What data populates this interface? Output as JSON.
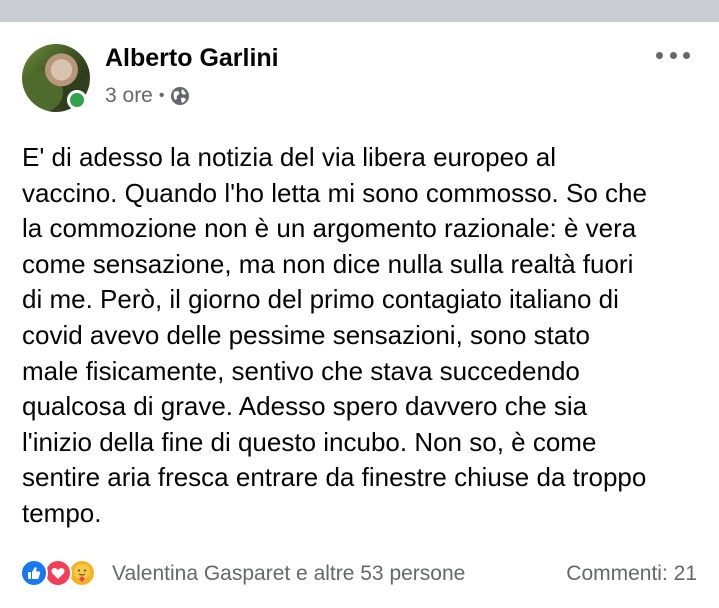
{
  "post": {
    "author": "Alberto Garlini",
    "time": "3 ore",
    "separator": "•",
    "privacy_icon": "globe-icon",
    "more_icon": "more-horizontal-icon",
    "body_lines": [
      "E' di adesso la notizia del via libera europeo al",
      "vaccino. Quando l'ho letta mi sono commosso. So che",
      "la commozione non è un argomento razionale: è vera",
      "come sensazione, ma non dice nulla sulla realtà fuori",
      "di me. Però, il giorno del primo contagiato italiano di",
      "covid avevo delle pessime sensazioni, sono stato",
      "male fisicamente, sentivo che stava succedendo",
      "qualcosa di grave. Adesso spero davvero che sia",
      "l'inizio della fine di questo incubo. Non so, è come",
      "sentire aria fresca entrare da finestre chiuse da troppo",
      "tempo."
    ]
  },
  "footer": {
    "reaction_icons": [
      "like-icon",
      "love-icon",
      "care-icon"
    ],
    "reactors_text": "Valentina Gasparet e altre 53 persone",
    "comments_text": "Commenti: 21"
  },
  "colors": {
    "online": "#31a24c",
    "like": "#1877f2",
    "love": "#f33e58",
    "care": "#f7b125",
    "secondary_text": "#65676b"
  }
}
